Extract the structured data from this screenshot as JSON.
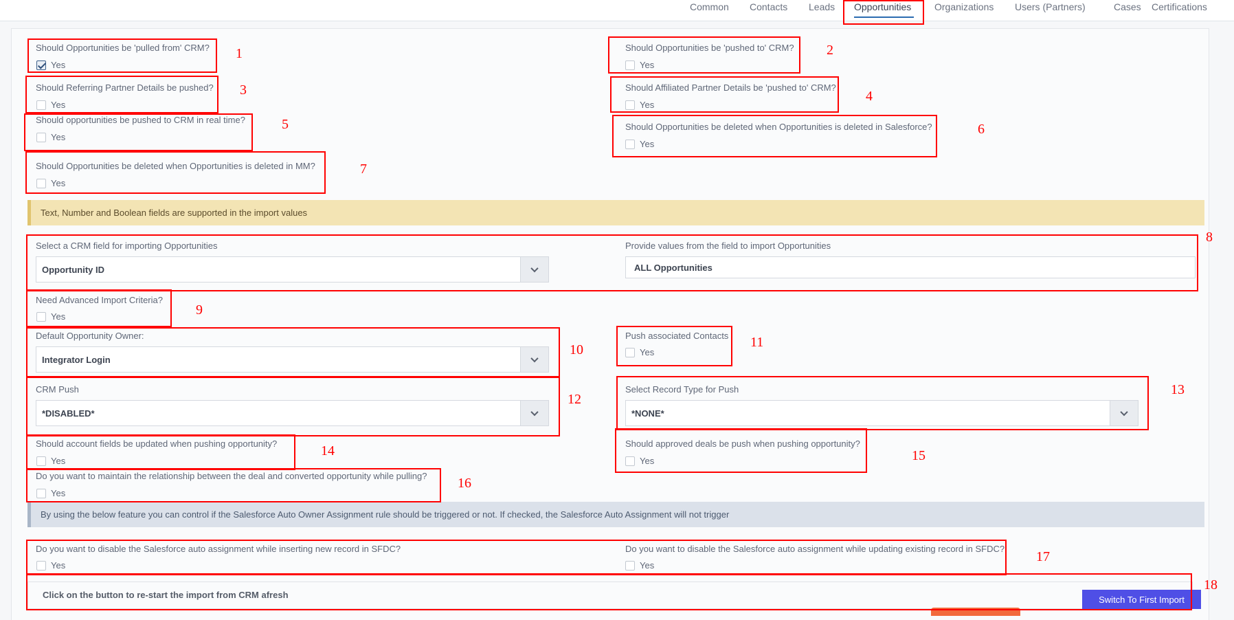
{
  "tabs": [
    {
      "label": "Common"
    },
    {
      "label": "Contacts"
    },
    {
      "label": "Leads"
    },
    {
      "label": "Opportunities",
      "active": true
    },
    {
      "label": "Organizations"
    },
    {
      "label": "Users (Partners)"
    },
    {
      "label": "Cases"
    },
    {
      "label": "Certifications"
    }
  ],
  "yes_label": "Yes",
  "questions": {
    "q1": {
      "text": "Should Opportunities be 'pulled from' CRM?",
      "checked": true
    },
    "q2": {
      "text": "Should Opportunities be 'pushed to' CRM?",
      "checked": false
    },
    "q3": {
      "text": "Should Referring Partner Details be pushed?",
      "checked": false
    },
    "q4": {
      "text": "Should Affiliated Partner Details be 'pushed to' CRM?",
      "checked": false
    },
    "q5": {
      "text": "Should opportunities be pushed to CRM in real time?",
      "checked": false
    },
    "q6": {
      "text": "Should Opportunities be deleted when Opportunities is deleted in Salesforce?",
      "checked": false
    },
    "q7": {
      "text": "Should Opportunities be deleted when Opportunities is deleted in MM?",
      "checked": false
    },
    "q9": {
      "text": "Need Advanced Import Criteria?",
      "checked": false
    },
    "q11": {
      "text": "Push associated Contacts",
      "checked": false
    },
    "q14": {
      "text": "Should account fields be updated when pushing opportunity?",
      "checked": false
    },
    "q15": {
      "text": "Should approved deals be push when pushing opportunity?",
      "checked": false
    },
    "q16": {
      "text": "Do you want to maintain the relationship between the deal and converted opportunity while pulling?",
      "checked": false
    },
    "q17a": {
      "text": "Do you want to disable the Salesforce auto assignment while inserting new record in SFDC?",
      "checked": false
    },
    "q17b": {
      "text": "Do you want to disable the Salesforce auto assignment while updating existing record in SFDC?",
      "checked": false
    }
  },
  "banner_import": "Text, Number and Boolean fields are supported in the import values",
  "crm_field": {
    "label": "Select a CRM field for importing Opportunities",
    "value": "Opportunity ID"
  },
  "import_values": {
    "label": "Provide values from the field to import Opportunities",
    "value": "ALL Opportunities"
  },
  "default_owner": {
    "label": "Default Opportunity Owner:",
    "value": "Integrator Login"
  },
  "crm_push": {
    "label": "CRM Push",
    "value": "*DISABLED*"
  },
  "record_type": {
    "label": "Select Record Type for Push",
    "value": "*NONE*"
  },
  "banner_assignment": "By using the below feature you can control if the Salesforce Auto Owner Assignment rule should be triggered or not. If checked, the Salesforce Auto Assignment will not trigger",
  "restart": {
    "text": "Click on the button to re-start the import from CRM afresh",
    "button": "Switch To First Import"
  },
  "annotations": [
    "1",
    "2",
    "3",
    "4",
    "5",
    "6",
    "7",
    "8",
    "9",
    "10",
    "11",
    "12",
    "13",
    "14",
    "15",
    "16",
    "17",
    "18"
  ],
  "colors": {
    "annotation": "#ff0000",
    "primary_button": "#4f4fe6",
    "tab_underline": "#2b6cb0",
    "warning_banner": "#f3e4b4",
    "info_banner": "#dbe1ea"
  }
}
